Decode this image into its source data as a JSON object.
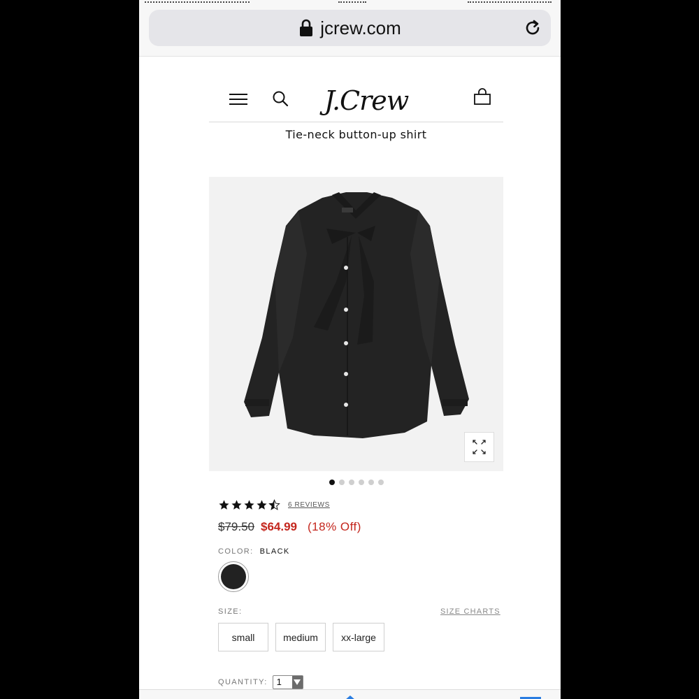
{
  "browser": {
    "url": "jcrew.com"
  },
  "header": {
    "logo_text": "J.Crew"
  },
  "product": {
    "title": "Tie-neck button-up shirt",
    "image_count": 6,
    "active_image": 1,
    "rating": 4.5,
    "reviews_label": "6 REVIEWS",
    "price_original": "$79.50",
    "price_sale": "$64.99",
    "discount_label": "(18% Off)",
    "color_label": "COLOR:",
    "color_value": "BLACK",
    "swatch_color": "#222222",
    "size_label": "SIZE:",
    "size_charts_label": "SIZE CHARTS",
    "sizes": [
      "small",
      "medium",
      "xx-large"
    ],
    "quantity_label": "QUANTITY:",
    "quantity_value": "1"
  },
  "colors": {
    "sale_red": "#c4261d",
    "text_dark": "#111111"
  }
}
